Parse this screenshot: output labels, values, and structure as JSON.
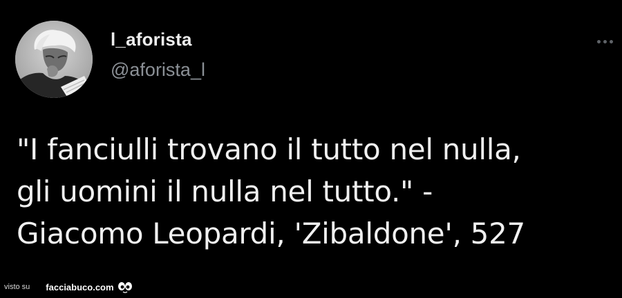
{
  "author": {
    "display_name": "l_aforista",
    "handle": "@aforista_l",
    "avatar_icon": "portrait-photo"
  },
  "menu": {
    "icon": "more-options-icon"
  },
  "tweet": {
    "lines": [
      "\"I fanciulli trovano il tutto nel nulla,",
      "gli uomini il nulla nel tutto.\" -",
      "Giacomo Leopardi, 'Zibaldone', 527"
    ]
  },
  "watermark": {
    "prefix": "visto su",
    "site": "facciabuco.com",
    "logo_icon": "facciabuco-eyes-icon"
  },
  "colors": {
    "background": "#000000",
    "text": "#f0f0f0",
    "secondary_text": "#8b9096"
  }
}
